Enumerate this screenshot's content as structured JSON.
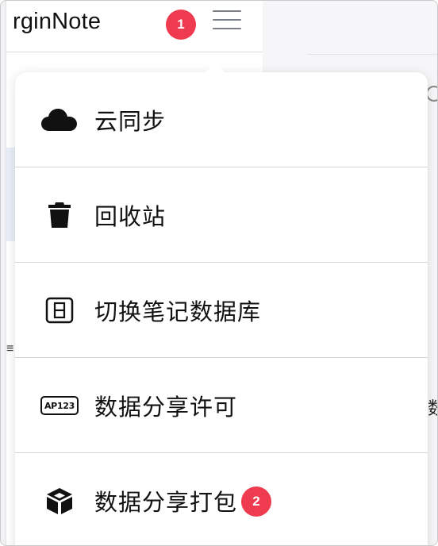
{
  "app": {
    "title": "rginNote"
  },
  "badges": {
    "step_1": "1",
    "step_2": "2"
  },
  "menu": {
    "items": [
      {
        "label": "云同步",
        "icon": "cloud-icon"
      },
      {
        "label": "回收站",
        "icon": "trash-icon"
      },
      {
        "label": "切换笔记数据库",
        "icon": "database-switch-icon"
      },
      {
        "label": "数据分享许可",
        "icon": "license-icon",
        "icon_text": "AP123"
      },
      {
        "label": "数据分享打包",
        "icon": "package-box-icon"
      }
    ]
  },
  "colors": {
    "badge": "#ef3b4f",
    "hamburger": "#7a7f87"
  }
}
